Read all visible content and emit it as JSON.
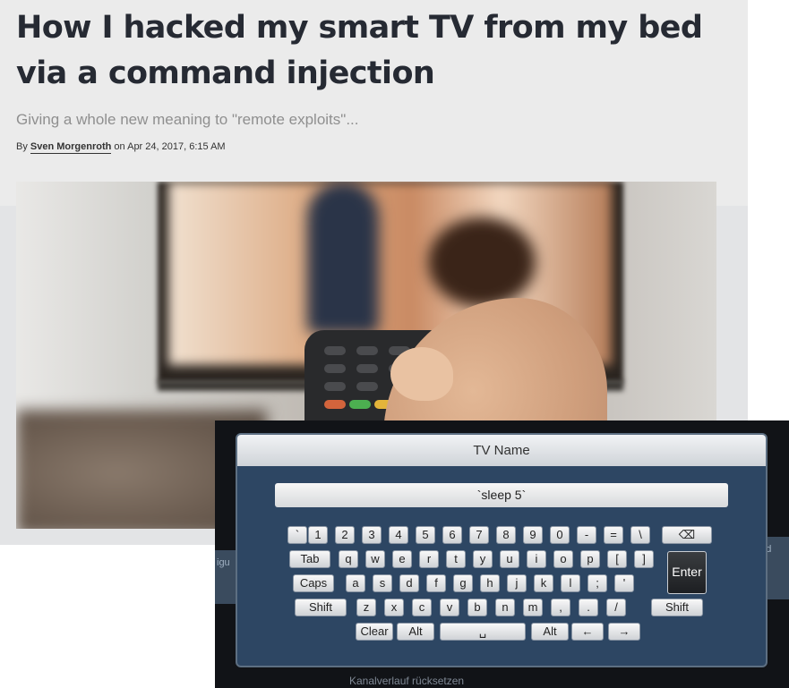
{
  "article": {
    "title": "How I hacked my smart TV from my bed via a command injection",
    "subtitle": "Giving a whole new meaning to \"remote exploits\"...",
    "byline_prefix": "By",
    "author": "Sven Morgenroth",
    "date_text": "on Apr 24, 2017, 6:15 AM"
  },
  "tv": {
    "dialog_title": "TV Name",
    "input_value": "`sleep 5`",
    "left_partial_label": "igu",
    "right_partial_label": "Bild",
    "bottom_text": "Kanalverlauf rücksetzen",
    "keys": {
      "backtick": "`",
      "k1": "1",
      "k2": "2",
      "k3": "3",
      "k4": "4",
      "k5": "5",
      "k6": "6",
      "k7": "7",
      "k8": "8",
      "k9": "9",
      "k0": "0",
      "minus": "-",
      "equals": "=",
      "backslash": "\\",
      "backspace": "⌫",
      "tab": "Tab",
      "q": "q",
      "w": "w",
      "e": "e",
      "r": "r",
      "t": "t",
      "y": "y",
      "u": "u",
      "i": "i",
      "o": "o",
      "p": "p",
      "lbracket": "[",
      "rbracket": "]",
      "enter": "Enter",
      "caps": "Caps",
      "a": "a",
      "s": "s",
      "d": "d",
      "f": "f",
      "g": "g",
      "h": "h",
      "j": "j",
      "k": "k",
      "l": "l",
      "semicolon": ";",
      "quote": "'",
      "shift": "Shift",
      "z": "z",
      "x": "x",
      "c": "c",
      "v": "v",
      "b": "b",
      "n": "n",
      "m": "m",
      "comma": ",",
      "period": ".",
      "slash": "/",
      "clear": "Clear",
      "alt": "Alt",
      "space": "␣",
      "left": "←",
      "right": "→"
    }
  }
}
